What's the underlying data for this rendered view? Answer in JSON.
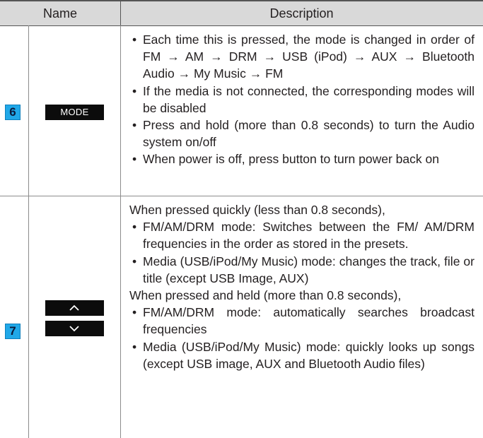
{
  "header": {
    "name": "Name",
    "description": "Description"
  },
  "rows": [
    {
      "number": "6",
      "button_label": "MODE",
      "items": [
        "Each time this is pressed, the mode is changed in order of FM → AM → DRM → USB (iPod) → AUX → Bluetooth Audio → My Music → FM",
        "If the media is not connected, the corresponding modes will be disabled",
        "Press and hold (more than 0.8 seconds) to turn the Audio system on/off",
        "When power is off, press button to turn power back on"
      ]
    },
    {
      "number": "7",
      "buttons": [
        "chevron-up-icon",
        "chevron-down-icon"
      ],
      "intro_pressed": "When pressed quickly (less than 0.8 seconds),",
      "pressed_items": [
        "FM/AM/DRM mode: Switches between the FM/ AM/DRM frequencies in the order as stored in the presets.",
        "Media (USB/iPod/My Music) mode: changes the track, file or title (except USB Image, AUX)"
      ],
      "intro_held": "When pressed and held (more than 0.8 seconds),",
      "held_items": [
        "FM/AM/DRM mode: automatically searches broadcast frequencies",
        "Media (USB/iPod/My Music) mode: quickly looks up songs (except USB image, AUX and Bluetooth Audio files)"
      ]
    }
  ]
}
